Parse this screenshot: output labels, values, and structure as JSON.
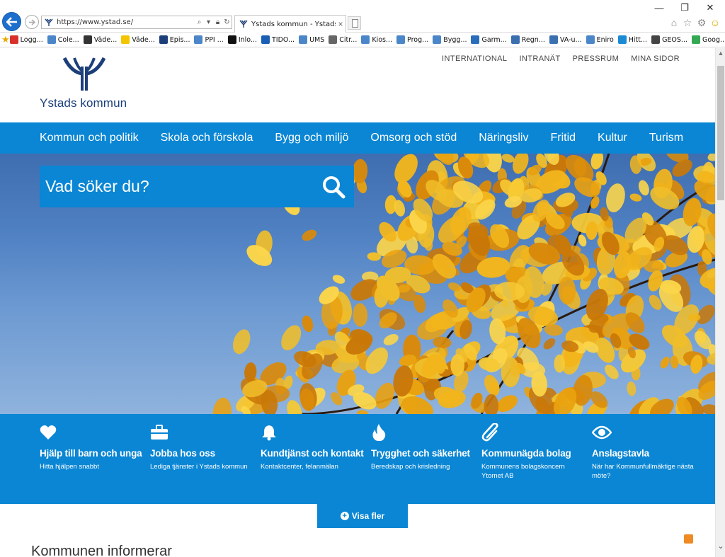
{
  "browser": {
    "url": "https://www.ystad.se/",
    "tab_title": "Ystads kommun - Ystads ko...",
    "tab_close": "×",
    "favorites": [
      {
        "label": "Logg...",
        "color": "#d8312b"
      },
      {
        "label": "Cole...",
        "color": "#4b86c8"
      },
      {
        "label": "Väde...",
        "color": "#333333"
      },
      {
        "label": "Väde...",
        "color": "#f2c500"
      },
      {
        "label": "Epis...",
        "color": "#1c3f7a"
      },
      {
        "label": "PPI ...",
        "color": "#4b86c8"
      },
      {
        "label": "Inlo...",
        "color": "#111111"
      },
      {
        "label": "TIDO...",
        "color": "#1a5fb4"
      },
      {
        "label": "UMS",
        "color": "#4b86c8"
      },
      {
        "label": "Citr...",
        "color": "#666666"
      },
      {
        "label": "Kios...",
        "color": "#4b86c8"
      },
      {
        "label": "Prog...",
        "color": "#4b86c8"
      },
      {
        "label": "Bygg...",
        "color": "#4b86c8"
      },
      {
        "label": "Garm...",
        "color": "#2a6ebb"
      },
      {
        "label": "Regn...",
        "color": "#3a6fb0"
      },
      {
        "label": "VA-u...",
        "color": "#3a6fb0"
      },
      {
        "label": "Eniro",
        "color": "#4b86c8"
      },
      {
        "label": "Hitt...",
        "color": "#1a8ad4"
      },
      {
        "label": "GEOS...",
        "color": "#444444"
      },
      {
        "label": "Goog...",
        "color": "#34a853"
      }
    ]
  },
  "header": {
    "logo_text": "Ystads kommun",
    "top_links": [
      "INTERNATIONAL",
      "INTRANÄT",
      "PRESSRUM",
      "MINA SIDOR"
    ]
  },
  "nav": [
    "Kommun och politik",
    "Skola och förskola",
    "Bygg och miljö",
    "Omsorg och stöd",
    "Näringsliv",
    "Fritid",
    "Kultur",
    "Turism"
  ],
  "search": {
    "placeholder": "Vad söker du?"
  },
  "quick_links": [
    {
      "icon": "heart-icon",
      "title": "Hjälp till barn och unga",
      "sub": "Hitta hjälpen snabbt"
    },
    {
      "icon": "briefcase-icon",
      "title": "Jobba hos oss",
      "sub": "Lediga tjänster i Ystads kommun"
    },
    {
      "icon": "bell-icon",
      "title": "Kundtjänst och kontakt",
      "sub": "Kontaktcenter, felanmälan"
    },
    {
      "icon": "flame-icon",
      "title": "Trygghet och säkerhet",
      "sub": "Beredskap och krisledning"
    },
    {
      "icon": "paperclip-icon",
      "title": "Kommunägda bolag",
      "sub": "Kommunens bolagskoncern Ytornet AB"
    },
    {
      "icon": "eye-icon",
      "title": "Anslagstavla",
      "sub": "När har Kommunfullmäktige nästa möte?"
    }
  ],
  "more_button": "Visa fler",
  "section_title": "Kommunen informerar",
  "colors": {
    "brand_blue": "#0a86d4",
    "logo_navy": "#1c3f7a"
  }
}
